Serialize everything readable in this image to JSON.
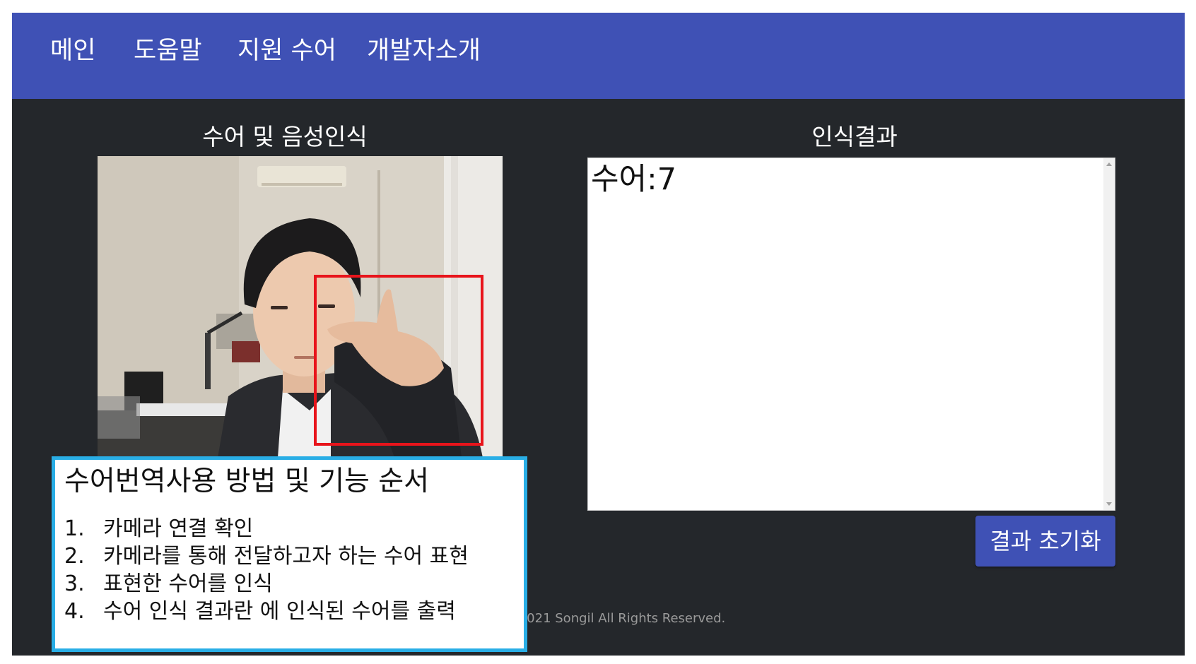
{
  "nav": {
    "items": [
      {
        "label": "메인"
      },
      {
        "label": "도움말"
      },
      {
        "label": "지원 수어"
      },
      {
        "label": "개발자소개"
      }
    ]
  },
  "left": {
    "title": "수어 및 음성인식",
    "camera": {
      "icon": "webcam-feed-image",
      "detection_color": "#e8141b"
    }
  },
  "right": {
    "title": "인식결과",
    "result_text": "수어:7",
    "reset_label": "결과 초기화"
  },
  "guide": {
    "title": "수어번역사용 방법 및 기능 순서",
    "steps": [
      {
        "num": "1.",
        "text": "카메라 연결 확인"
      },
      {
        "num": "2.",
        "text": "카메라를 통해 전달하고자 하는 수어 표현"
      },
      {
        "num": "3.",
        "text": "표현한 수어를 인식"
      },
      {
        "num": "4.",
        "text": "수어 인식 결과란 에 인식된 수어를 출력"
      }
    ],
    "border_color": "#29aee6"
  },
  "footer": {
    "text": "© 2021 Songil All Rights Reserved."
  },
  "colors": {
    "nav": "#3f51b5",
    "background": "#24272b",
    "button": "#3f51b5"
  }
}
